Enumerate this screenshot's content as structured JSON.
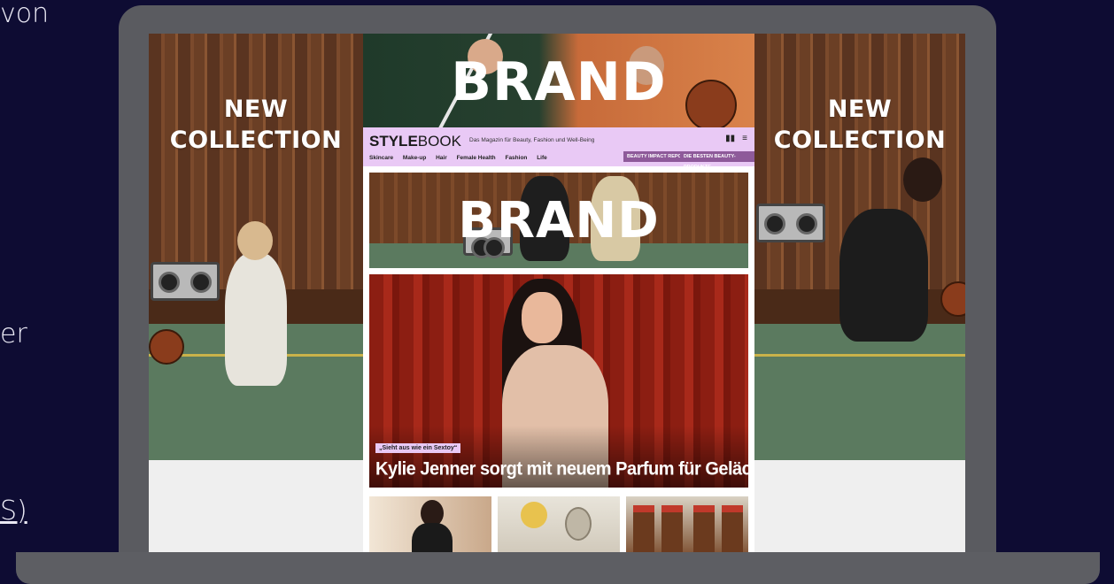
{
  "page_text": {
    "line1": "von",
    "line2": "er",
    "line3": "S)"
  },
  "ads": {
    "left_title": [
      "NEW",
      "COLLECTION"
    ],
    "right_title": [
      "NEW",
      "COLLECTION"
    ],
    "brand_label": "BRAND"
  },
  "site": {
    "logo_bold": "STYLE",
    "logo_light": "BOOK",
    "tagline": "Das Magazin für Beauty, Fashion und Well-Being",
    "nav": [
      "Skincare",
      "Make-up",
      "Hair",
      "Female Health",
      "Fashion",
      "Life"
    ],
    "pills": [
      "Beauty Impact Report",
      "Die besten Beauty-Produkte"
    ],
    "icons": [
      "bild-logo-icon",
      "menu-icon"
    ]
  },
  "hero": {
    "kicker": "„Sieht aus wie ein Sextoy“",
    "headline": "Kylie Jenner sorgt mit neuem Parfum für Gelächter"
  },
  "colors": {
    "background": "#0e0c33",
    "masthead": "#e9c9f5",
    "pill": "#8e5a9a",
    "laptop": "#5a5b60"
  }
}
